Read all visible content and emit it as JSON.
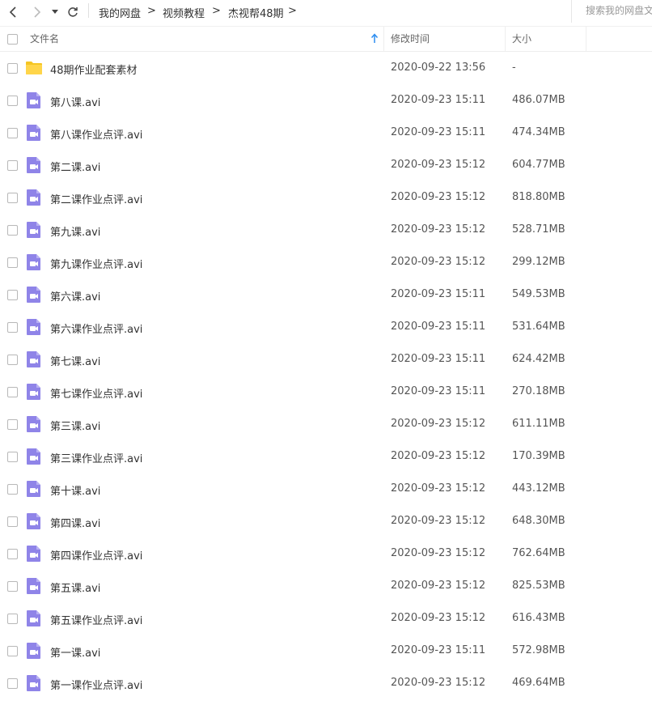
{
  "toolbar": {
    "breadcrumbs": [
      "我的网盘",
      "视频教程",
      "杰视帮48期"
    ],
    "crumb_sep": ">",
    "search_placeholder": "搜索我的网盘文件"
  },
  "header": {
    "name": "文件名",
    "modified": "修改时间",
    "size": "大小"
  },
  "colors": {
    "folder": "#f5c523",
    "video": "#8f84e8",
    "sort_arrow": "#2b8cf0"
  },
  "files": [
    {
      "name": "48期作业配套素材",
      "type": "folder",
      "modified": "2020-09-22 13:56",
      "size": "-"
    },
    {
      "name": "第八课.avi",
      "type": "video",
      "modified": "2020-09-23 15:11",
      "size": "486.07MB"
    },
    {
      "name": "第八课作业点评.avi",
      "type": "video",
      "modified": "2020-09-23 15:11",
      "size": "474.34MB"
    },
    {
      "name": "第二课.avi",
      "type": "video",
      "modified": "2020-09-23 15:12",
      "size": "604.77MB"
    },
    {
      "name": "第二课作业点评.avi",
      "type": "video",
      "modified": "2020-09-23 15:12",
      "size": "818.80MB"
    },
    {
      "name": "第九课.avi",
      "type": "video",
      "modified": "2020-09-23 15:12",
      "size": "528.71MB"
    },
    {
      "name": "第九课作业点评.avi",
      "type": "video",
      "modified": "2020-09-23 15:12",
      "size": "299.12MB"
    },
    {
      "name": "第六课.avi",
      "type": "video",
      "modified": "2020-09-23 15:11",
      "size": "549.53MB"
    },
    {
      "name": "第六课作业点评.avi",
      "type": "video",
      "modified": "2020-09-23 15:11",
      "size": "531.64MB"
    },
    {
      "name": "第七课.avi",
      "type": "video",
      "modified": "2020-09-23 15:11",
      "size": "624.42MB"
    },
    {
      "name": "第七课作业点评.avi",
      "type": "video",
      "modified": "2020-09-23 15:11",
      "size": "270.18MB"
    },
    {
      "name": "第三课.avi",
      "type": "video",
      "modified": "2020-09-23 15:12",
      "size": "611.11MB"
    },
    {
      "name": "第三课作业点评.avi",
      "type": "video",
      "modified": "2020-09-23 15:12",
      "size": "170.39MB"
    },
    {
      "name": "第十课.avi",
      "type": "video",
      "modified": "2020-09-23 15:12",
      "size": "443.12MB"
    },
    {
      "name": "第四课.avi",
      "type": "video",
      "modified": "2020-09-23 15:12",
      "size": "648.30MB"
    },
    {
      "name": "第四课作业点评.avi",
      "type": "video",
      "modified": "2020-09-23 15:12",
      "size": "762.64MB"
    },
    {
      "name": "第五课.avi",
      "type": "video",
      "modified": "2020-09-23 15:12",
      "size": "825.53MB"
    },
    {
      "name": "第五课作业点评.avi",
      "type": "video",
      "modified": "2020-09-23 15:12",
      "size": "616.43MB"
    },
    {
      "name": "第一课.avi",
      "type": "video",
      "modified": "2020-09-23 15:11",
      "size": "572.98MB"
    },
    {
      "name": "第一课作业点评.avi",
      "type": "video",
      "modified": "2020-09-23 15:12",
      "size": "469.64MB"
    }
  ]
}
